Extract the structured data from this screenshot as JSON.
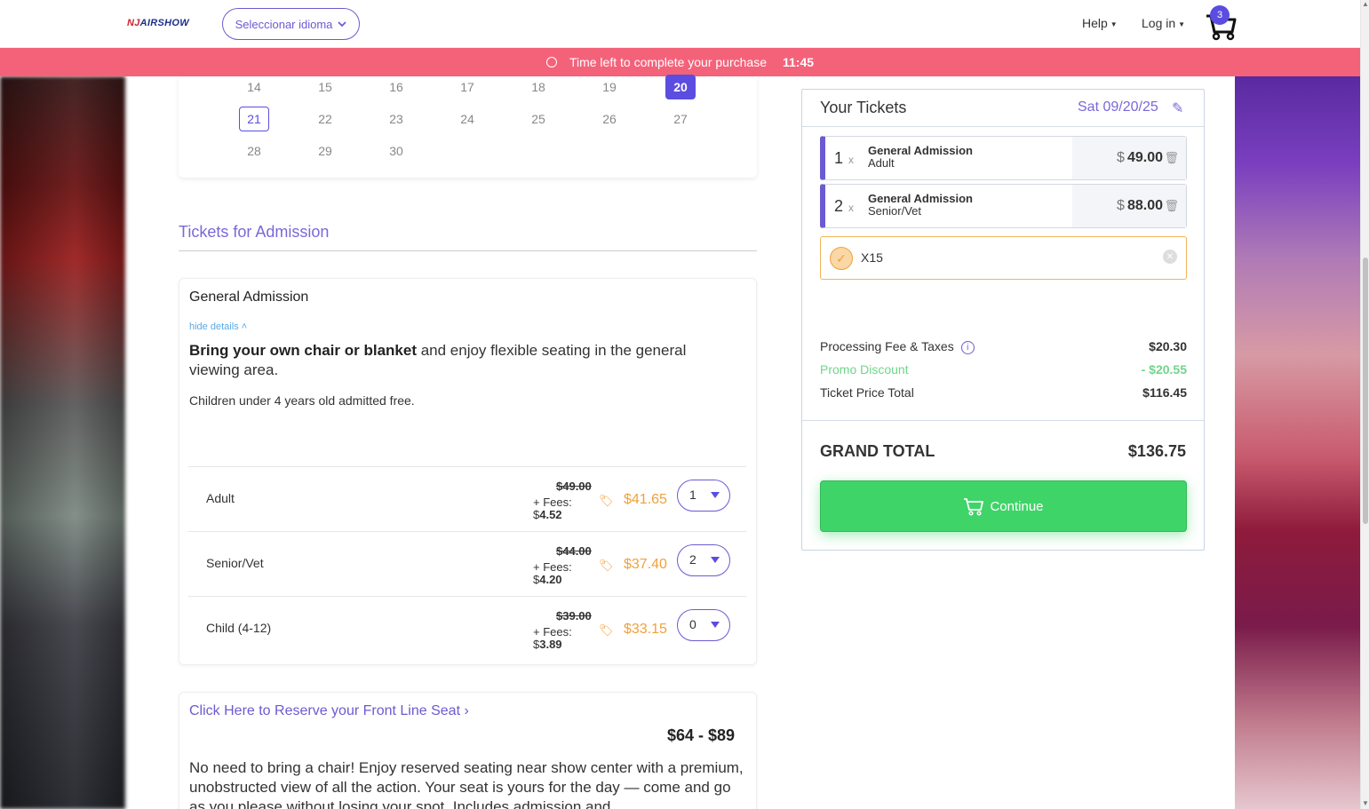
{
  "header": {
    "logo_left": "NJ",
    "logo_right": "AIRSHOW",
    "language_button": "Seleccionar idioma",
    "help": "Help",
    "login": "Log in",
    "cart_count": "3"
  },
  "timer": {
    "label": "Time left to complete your purchase",
    "time": "11:45"
  },
  "calendar": {
    "rows": [
      [
        "14",
        "15",
        "16",
        "17",
        "18",
        "19",
        "20"
      ],
      [
        "21",
        "22",
        "23",
        "24",
        "25",
        "26",
        "27"
      ],
      [
        "28",
        "29",
        "30"
      ]
    ],
    "selected": "20",
    "highlighted": "21"
  },
  "tickets_section": {
    "title": "Tickets for Admission",
    "card_title": "General Admission",
    "hide_details": "hide details",
    "desc_bold": "Bring your own chair or blanket",
    "desc_rest": " and enjoy flexible seating in the general viewing area.",
    "note": "Children under 4 years old admitted free.",
    "fees_label": "+ Fees:",
    "types": [
      {
        "name": "Adult",
        "original": "$49.00",
        "fee_symbol": "$",
        "fee": "4.52",
        "price": "$41.65",
        "qty": "1"
      },
      {
        "name": "Senior/Vet",
        "original": "$44.00",
        "fee_symbol": "$",
        "fee": "4.20",
        "price": "$37.40",
        "qty": "2"
      },
      {
        "name": "Child (4-12)",
        "original": "$39.00",
        "fee_symbol": "$",
        "fee": "3.89",
        "price": "$33.15",
        "qty": "0"
      }
    ]
  },
  "reserve": {
    "link": "Click Here to Reserve your Front Line Seat",
    "price_range": "$64 - $89",
    "desc": "No need to bring a chair! Enjoy reserved seating near show center with a premium, unobstructed view of all the action. Your seat is yours for the day — come and go as you please without losing your spot. Includes admission and"
  },
  "panel": {
    "title": "Your Tickets",
    "date": "Sat 09/20/25",
    "items": [
      {
        "qty": "1",
        "x": "x",
        "name": "General Admission",
        "type": "Adult",
        "symbol": "$",
        "price": "49.00"
      },
      {
        "qty": "2",
        "x": "x",
        "name": "General Admission",
        "type": "Senior/Vet",
        "symbol": "$",
        "price": "88.00"
      }
    ],
    "promo_code": "X15",
    "fees_label": "Processing Fee & Taxes",
    "fees_value": "$20.30",
    "promo_label": "Promo Discount",
    "promo_value": "- $20.55",
    "ticket_total_label": "Ticket Price Total",
    "ticket_total_value": "$116.45",
    "grand_label": "GRAND TOTAL",
    "grand_value": "$136.75",
    "continue_label": "Continue"
  },
  "colors": {
    "accent": "#6b5bd1",
    "timer_bar": "#f4627a",
    "price_orange": "#f2a03a",
    "continue_green": "#3fd468",
    "promo_green": "#6fd68a"
  },
  "icons": [
    "clock-icon",
    "chevron-down-icon",
    "cart-icon",
    "pencil-icon",
    "trash-icon",
    "check-icon",
    "clear-icon",
    "info-icon",
    "tag-icon",
    "chevron-right-icon"
  ]
}
